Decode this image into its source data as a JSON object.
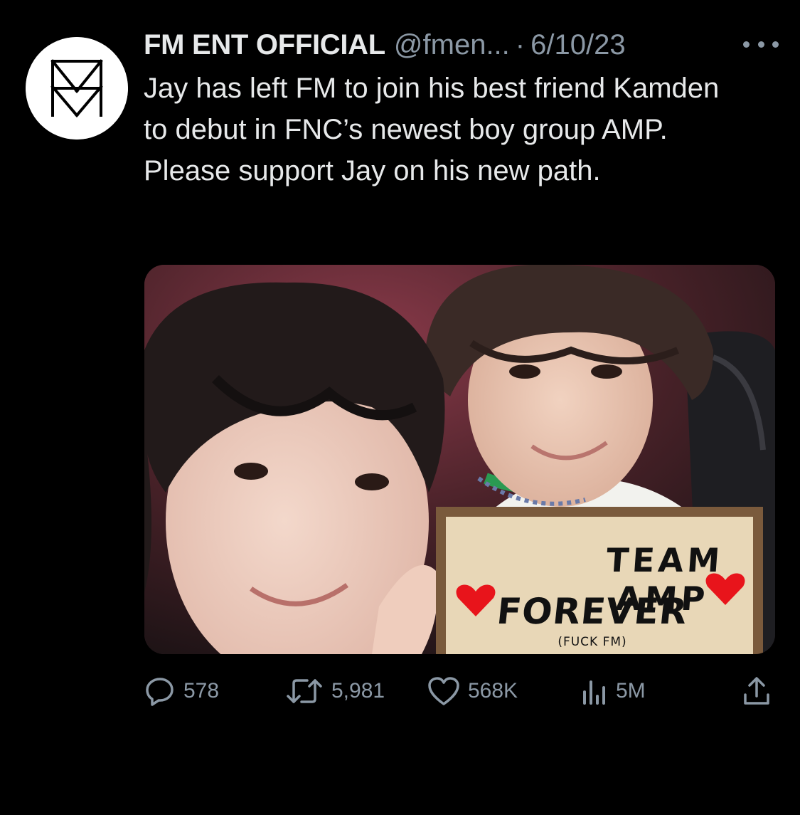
{
  "tweet": {
    "display_name": "FM ENT OFFICIAL",
    "handle": "@fmen...",
    "separator": "·",
    "date": "6/10/23",
    "text": "Jay has left FM to join his best friend Kamden to debut in FNC’s newest boy group AMP. Please support Jay on his new path.",
    "avatar_icon": "fm-logo-icon",
    "more_icon": "more-options-icon"
  },
  "media": {
    "description_icon": "photo-two-people-with-sign",
    "sign": {
      "line1": "TEAM AMP",
      "line2": "FOREVER",
      "line3": "(FUCK FM)"
    },
    "heart_color": "#e8141b"
  },
  "actions": {
    "reply": {
      "icon": "reply-icon",
      "count": "578"
    },
    "retweet": {
      "icon": "retweet-icon",
      "count": "5,981"
    },
    "like": {
      "icon": "heart-icon",
      "count": "568K"
    },
    "views": {
      "icon": "views-icon",
      "count": "5M"
    },
    "share": {
      "icon": "share-icon"
    }
  },
  "colors": {
    "background": "#000000",
    "text_primary": "#e7e9ea",
    "text_secondary": "#8b98a5"
  }
}
